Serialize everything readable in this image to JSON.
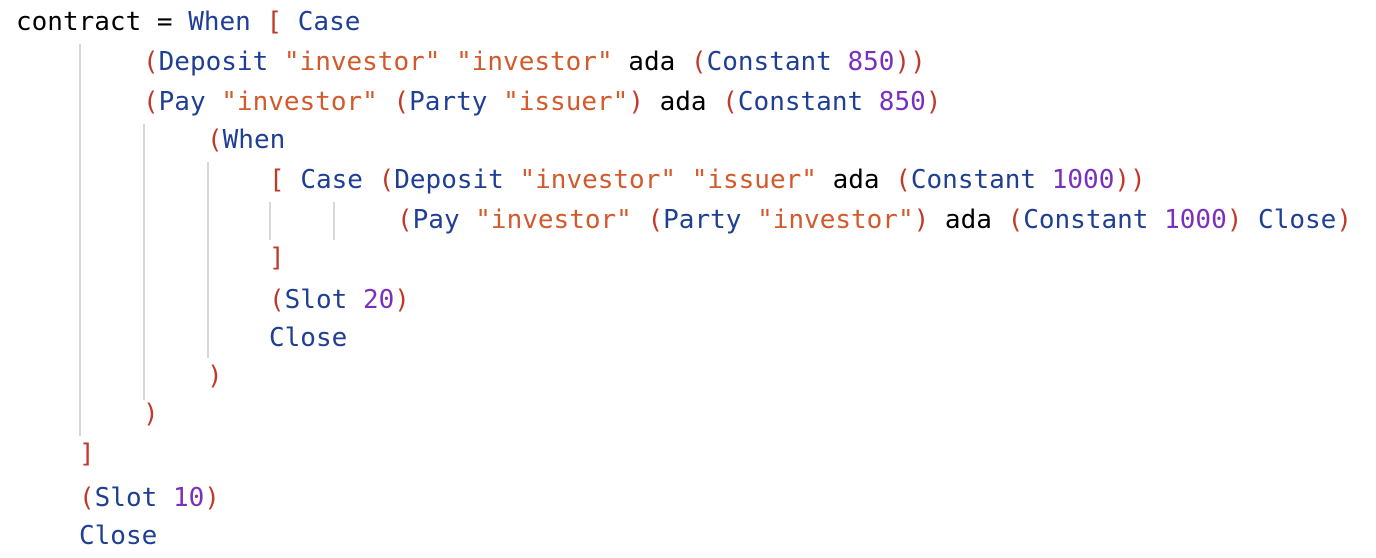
{
  "colors": {
    "plain": "#000000",
    "keyword": "#1f3f94",
    "bracket": "#c0392b",
    "string": "#d35a2c",
    "number": "#7b2fbf",
    "guide": "#d7d7d7",
    "background": "#ffffff"
  },
  "lines": [
    {
      "tokens": [
        {
          "text": "contract = ",
          "kind": "plain"
        },
        {
          "text": "When",
          "kind": "keyword"
        },
        {
          "text": " ",
          "kind": "plain"
        },
        {
          "text": "[",
          "kind": "bracket"
        },
        {
          "text": " ",
          "kind": "plain"
        },
        {
          "text": "Case",
          "kind": "keyword"
        }
      ]
    },
    {
      "tokens": [
        {
          "text": "(",
          "kind": "bracket"
        },
        {
          "text": "Deposit",
          "kind": "keyword"
        },
        {
          "text": " ",
          "kind": "plain"
        },
        {
          "text": "\"investor\"",
          "kind": "string"
        },
        {
          "text": " ",
          "kind": "plain"
        },
        {
          "text": "\"investor\"",
          "kind": "string"
        },
        {
          "text": " ada ",
          "kind": "plain"
        },
        {
          "text": "(",
          "kind": "bracket"
        },
        {
          "text": "Constant",
          "kind": "keyword"
        },
        {
          "text": " ",
          "kind": "plain"
        },
        {
          "text": "850",
          "kind": "number"
        },
        {
          "text": "))",
          "kind": "bracket"
        }
      ]
    },
    {
      "tokens": [
        {
          "text": "(",
          "kind": "bracket"
        },
        {
          "text": "Pay",
          "kind": "keyword"
        },
        {
          "text": " ",
          "kind": "plain"
        },
        {
          "text": "\"investor\"",
          "kind": "string"
        },
        {
          "text": " ",
          "kind": "plain"
        },
        {
          "text": "(",
          "kind": "bracket"
        },
        {
          "text": "Party",
          "kind": "keyword"
        },
        {
          "text": " ",
          "kind": "plain"
        },
        {
          "text": "\"issuer\"",
          "kind": "string"
        },
        {
          "text": ")",
          "kind": "bracket"
        },
        {
          "text": " ada ",
          "kind": "plain"
        },
        {
          "text": "(",
          "kind": "bracket"
        },
        {
          "text": "Constant",
          "kind": "keyword"
        },
        {
          "text": " ",
          "kind": "plain"
        },
        {
          "text": "850",
          "kind": "number"
        },
        {
          "text": ")",
          "kind": "bracket"
        }
      ]
    },
    {
      "tokens": [
        {
          "text": "(",
          "kind": "bracket"
        },
        {
          "text": "When",
          "kind": "keyword"
        }
      ]
    },
    {
      "tokens": [
        {
          "text": "[",
          "kind": "bracket"
        },
        {
          "text": " ",
          "kind": "plain"
        },
        {
          "text": "Case",
          "kind": "keyword"
        },
        {
          "text": " ",
          "kind": "plain"
        },
        {
          "text": "(",
          "kind": "bracket"
        },
        {
          "text": "Deposit",
          "kind": "keyword"
        },
        {
          "text": " ",
          "kind": "plain"
        },
        {
          "text": "\"investor\"",
          "kind": "string"
        },
        {
          "text": " ",
          "kind": "plain"
        },
        {
          "text": "\"issuer\"",
          "kind": "string"
        },
        {
          "text": " ada ",
          "kind": "plain"
        },
        {
          "text": "(",
          "kind": "bracket"
        },
        {
          "text": "Constant",
          "kind": "keyword"
        },
        {
          "text": " ",
          "kind": "plain"
        },
        {
          "text": "1000",
          "kind": "number"
        },
        {
          "text": "))",
          "kind": "bracket"
        }
      ]
    },
    {
      "tokens": [
        {
          "text": "(",
          "kind": "bracket"
        },
        {
          "text": "Pay",
          "kind": "keyword"
        },
        {
          "text": " ",
          "kind": "plain"
        },
        {
          "text": "\"investor\"",
          "kind": "string"
        },
        {
          "text": " ",
          "kind": "plain"
        },
        {
          "text": "(",
          "kind": "bracket"
        },
        {
          "text": "Party",
          "kind": "keyword"
        },
        {
          "text": " ",
          "kind": "plain"
        },
        {
          "text": "\"investor\"",
          "kind": "string"
        },
        {
          "text": ")",
          "kind": "bracket"
        },
        {
          "text": " ada ",
          "kind": "plain"
        },
        {
          "text": "(",
          "kind": "bracket"
        },
        {
          "text": "Constant",
          "kind": "keyword"
        },
        {
          "text": " ",
          "kind": "plain"
        },
        {
          "text": "1000",
          "kind": "number"
        },
        {
          "text": ")",
          "kind": "bracket"
        },
        {
          "text": " ",
          "kind": "plain"
        },
        {
          "text": "Close",
          "kind": "keyword"
        },
        {
          "text": ")",
          "kind": "bracket"
        }
      ]
    },
    {
      "tokens": [
        {
          "text": "]",
          "kind": "bracket"
        }
      ]
    },
    {
      "tokens": [
        {
          "text": "(",
          "kind": "bracket"
        },
        {
          "text": "Slot",
          "kind": "keyword"
        },
        {
          "text": " ",
          "kind": "plain"
        },
        {
          "text": "20",
          "kind": "number"
        },
        {
          "text": ")",
          "kind": "bracket"
        }
      ]
    },
    {
      "tokens": [
        {
          "text": "Close",
          "kind": "keyword"
        }
      ]
    },
    {
      "tokens": [
        {
          "text": ")",
          "kind": "bracket"
        }
      ]
    },
    {
      "tokens": [
        {
          "text": ")",
          "kind": "bracket"
        }
      ]
    },
    {
      "tokens": [
        {
          "text": "]",
          "kind": "bracket"
        }
      ]
    },
    {
      "tokens": [
        {
          "text": "(",
          "kind": "bracket"
        },
        {
          "text": "Slot",
          "kind": "keyword"
        },
        {
          "text": " ",
          "kind": "plain"
        },
        {
          "text": "10",
          "kind": "number"
        },
        {
          "text": ")",
          "kind": "bracket"
        }
      ]
    },
    {
      "tokens": [
        {
          "text": "Close",
          "kind": "keyword"
        }
      ]
    }
  ]
}
